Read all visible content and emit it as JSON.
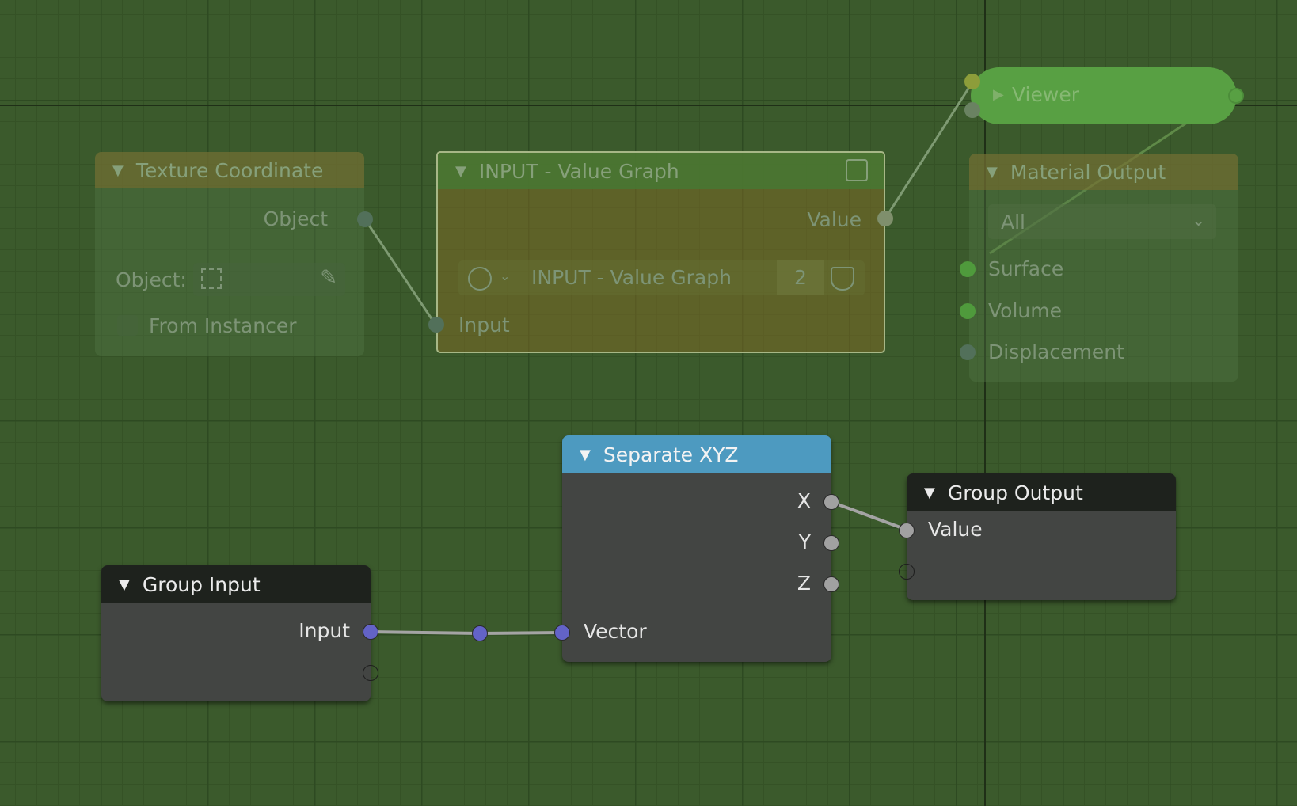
{
  "nodes": {
    "texture_coordinate": {
      "title": "Texture Coordinate",
      "output_object": "Object",
      "object_field_label": "Object:",
      "from_instancer": "From Instancer"
    },
    "value_graph": {
      "title": "INPUT - Value Graph",
      "output_value": "Value",
      "datablock_name": "INPUT - Value Graph",
      "user_count": "2",
      "input_label": "Input"
    },
    "viewer": {
      "title": "Viewer"
    },
    "material_output": {
      "title": "Material Output",
      "target": "All",
      "inputs": [
        "Surface",
        "Volume",
        "Displacement"
      ]
    },
    "separate_xyz": {
      "title": "Separate XYZ",
      "outputs": [
        "X",
        "Y",
        "Z"
      ],
      "input_vector": "Vector"
    },
    "group_output": {
      "title": "Group Output",
      "input_value": "Value"
    },
    "group_input": {
      "title": "Group Input",
      "output_input": "Input"
    }
  },
  "colors": {
    "background": "#3b5a2c",
    "node_body": "#434543",
    "header_dark": "#1e221d",
    "header_blue": "#4d9ac0",
    "socket_grey": "#a1a1a1",
    "socket_vector": "#6363c7"
  }
}
